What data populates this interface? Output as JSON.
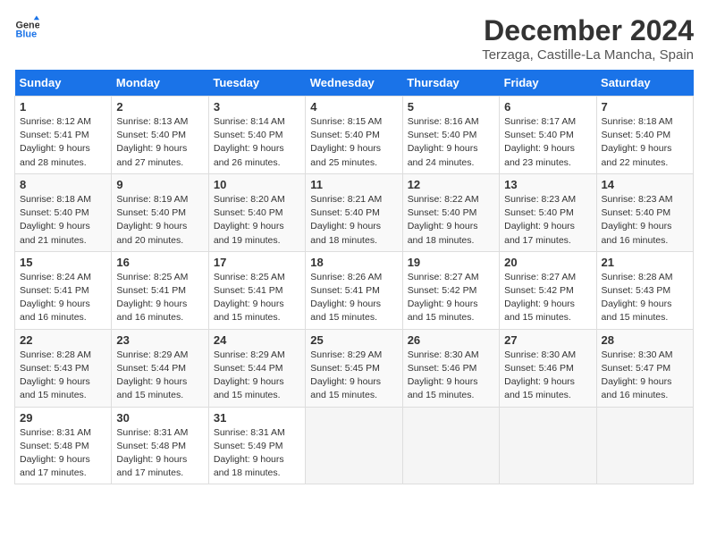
{
  "logo": {
    "line1": "General",
    "line2": "Blue"
  },
  "header": {
    "month": "December 2024",
    "location": "Terzaga, Castille-La Mancha, Spain"
  },
  "days_of_week": [
    "Sunday",
    "Monday",
    "Tuesday",
    "Wednesday",
    "Thursday",
    "Friday",
    "Saturday"
  ],
  "weeks": [
    [
      {
        "day": "1",
        "sunrise": "8:12 AM",
        "sunset": "5:41 PM",
        "daylight": "9 hours and 28 minutes."
      },
      {
        "day": "2",
        "sunrise": "8:13 AM",
        "sunset": "5:40 PM",
        "daylight": "9 hours and 27 minutes."
      },
      {
        "day": "3",
        "sunrise": "8:14 AM",
        "sunset": "5:40 PM",
        "daylight": "9 hours and 26 minutes."
      },
      {
        "day": "4",
        "sunrise": "8:15 AM",
        "sunset": "5:40 PM",
        "daylight": "9 hours and 25 minutes."
      },
      {
        "day": "5",
        "sunrise": "8:16 AM",
        "sunset": "5:40 PM",
        "daylight": "9 hours and 24 minutes."
      },
      {
        "day": "6",
        "sunrise": "8:17 AM",
        "sunset": "5:40 PM",
        "daylight": "9 hours and 23 minutes."
      },
      {
        "day": "7",
        "sunrise": "8:18 AM",
        "sunset": "5:40 PM",
        "daylight": "9 hours and 22 minutes."
      }
    ],
    [
      {
        "day": "8",
        "sunrise": "8:18 AM",
        "sunset": "5:40 PM",
        "daylight": "9 hours and 21 minutes."
      },
      {
        "day": "9",
        "sunrise": "8:19 AM",
        "sunset": "5:40 PM",
        "daylight": "9 hours and 20 minutes."
      },
      {
        "day": "10",
        "sunrise": "8:20 AM",
        "sunset": "5:40 PM",
        "daylight": "9 hours and 19 minutes."
      },
      {
        "day": "11",
        "sunrise": "8:21 AM",
        "sunset": "5:40 PM",
        "daylight": "9 hours and 18 minutes."
      },
      {
        "day": "12",
        "sunrise": "8:22 AM",
        "sunset": "5:40 PM",
        "daylight": "9 hours and 18 minutes."
      },
      {
        "day": "13",
        "sunrise": "8:23 AM",
        "sunset": "5:40 PM",
        "daylight": "9 hours and 17 minutes."
      },
      {
        "day": "14",
        "sunrise": "8:23 AM",
        "sunset": "5:40 PM",
        "daylight": "9 hours and 16 minutes."
      }
    ],
    [
      {
        "day": "15",
        "sunrise": "8:24 AM",
        "sunset": "5:41 PM",
        "daylight": "9 hours and 16 minutes."
      },
      {
        "day": "16",
        "sunrise": "8:25 AM",
        "sunset": "5:41 PM",
        "daylight": "9 hours and 16 minutes."
      },
      {
        "day": "17",
        "sunrise": "8:25 AM",
        "sunset": "5:41 PM",
        "daylight": "9 hours and 15 minutes."
      },
      {
        "day": "18",
        "sunrise": "8:26 AM",
        "sunset": "5:41 PM",
        "daylight": "9 hours and 15 minutes."
      },
      {
        "day": "19",
        "sunrise": "8:27 AM",
        "sunset": "5:42 PM",
        "daylight": "9 hours and 15 minutes."
      },
      {
        "day": "20",
        "sunrise": "8:27 AM",
        "sunset": "5:42 PM",
        "daylight": "9 hours and 15 minutes."
      },
      {
        "day": "21",
        "sunrise": "8:28 AM",
        "sunset": "5:43 PM",
        "daylight": "9 hours and 15 minutes."
      }
    ],
    [
      {
        "day": "22",
        "sunrise": "8:28 AM",
        "sunset": "5:43 PM",
        "daylight": "9 hours and 15 minutes."
      },
      {
        "day": "23",
        "sunrise": "8:29 AM",
        "sunset": "5:44 PM",
        "daylight": "9 hours and 15 minutes."
      },
      {
        "day": "24",
        "sunrise": "8:29 AM",
        "sunset": "5:44 PM",
        "daylight": "9 hours and 15 minutes."
      },
      {
        "day": "25",
        "sunrise": "8:29 AM",
        "sunset": "5:45 PM",
        "daylight": "9 hours and 15 minutes."
      },
      {
        "day": "26",
        "sunrise": "8:30 AM",
        "sunset": "5:46 PM",
        "daylight": "9 hours and 15 minutes."
      },
      {
        "day": "27",
        "sunrise": "8:30 AM",
        "sunset": "5:46 PM",
        "daylight": "9 hours and 15 minutes."
      },
      {
        "day": "28",
        "sunrise": "8:30 AM",
        "sunset": "5:47 PM",
        "daylight": "9 hours and 16 minutes."
      }
    ],
    [
      {
        "day": "29",
        "sunrise": "8:31 AM",
        "sunset": "5:48 PM",
        "daylight": "9 hours and 17 minutes."
      },
      {
        "day": "30",
        "sunrise": "8:31 AM",
        "sunset": "5:48 PM",
        "daylight": "9 hours and 17 minutes."
      },
      {
        "day": "31",
        "sunrise": "8:31 AM",
        "sunset": "5:49 PM",
        "daylight": "9 hours and 18 minutes."
      },
      null,
      null,
      null,
      null
    ]
  ]
}
